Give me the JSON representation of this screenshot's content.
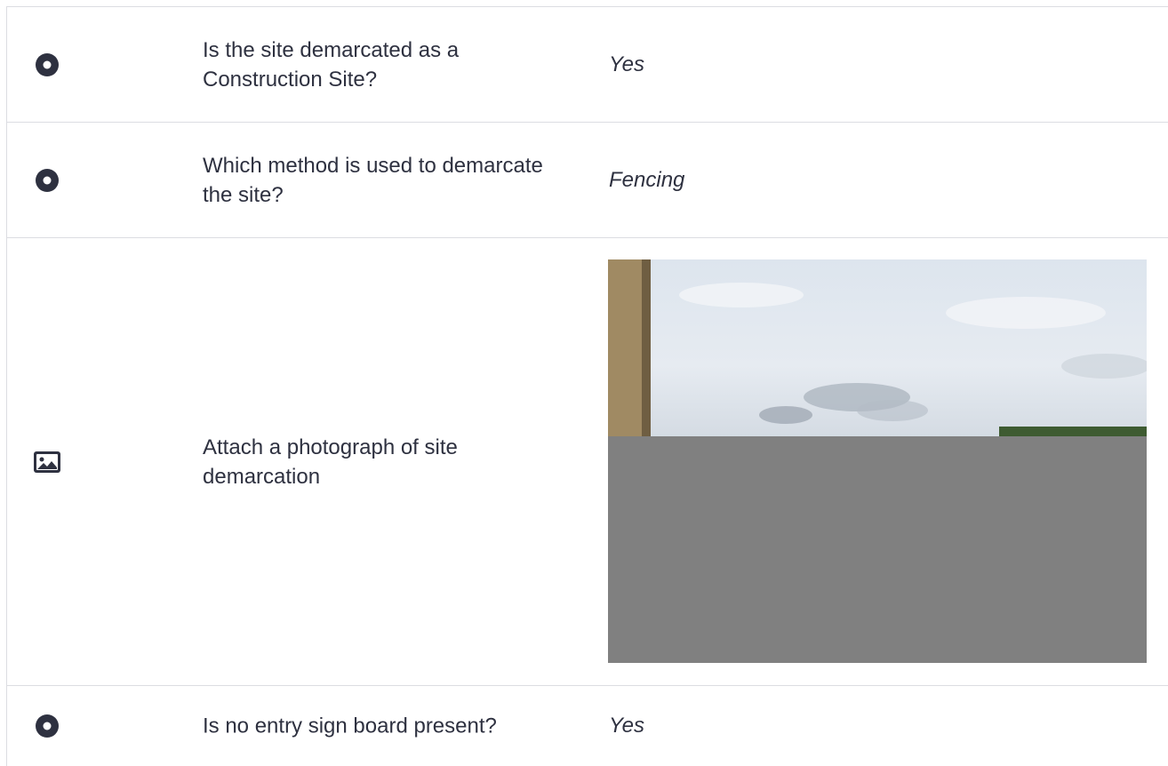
{
  "rows": [
    {
      "icon": "radio-icon",
      "question": "Is the site demarcated as a Construction Site?",
      "answer": "Yes"
    },
    {
      "icon": "radio-icon",
      "question": "Which method is used to demarcate the site?",
      "answer": "Fencing"
    },
    {
      "icon": "image-icon",
      "question": "Attach a photograph of site demarcation",
      "answer_type": "photo"
    },
    {
      "icon": "radio-icon",
      "question": "Is no entry sign board present?",
      "answer": "Yes"
    }
  ],
  "colors": {
    "text": "#2e3140",
    "icon": "#2e3140",
    "border": "#dcdde2",
    "photo_redacted": "#808080"
  }
}
